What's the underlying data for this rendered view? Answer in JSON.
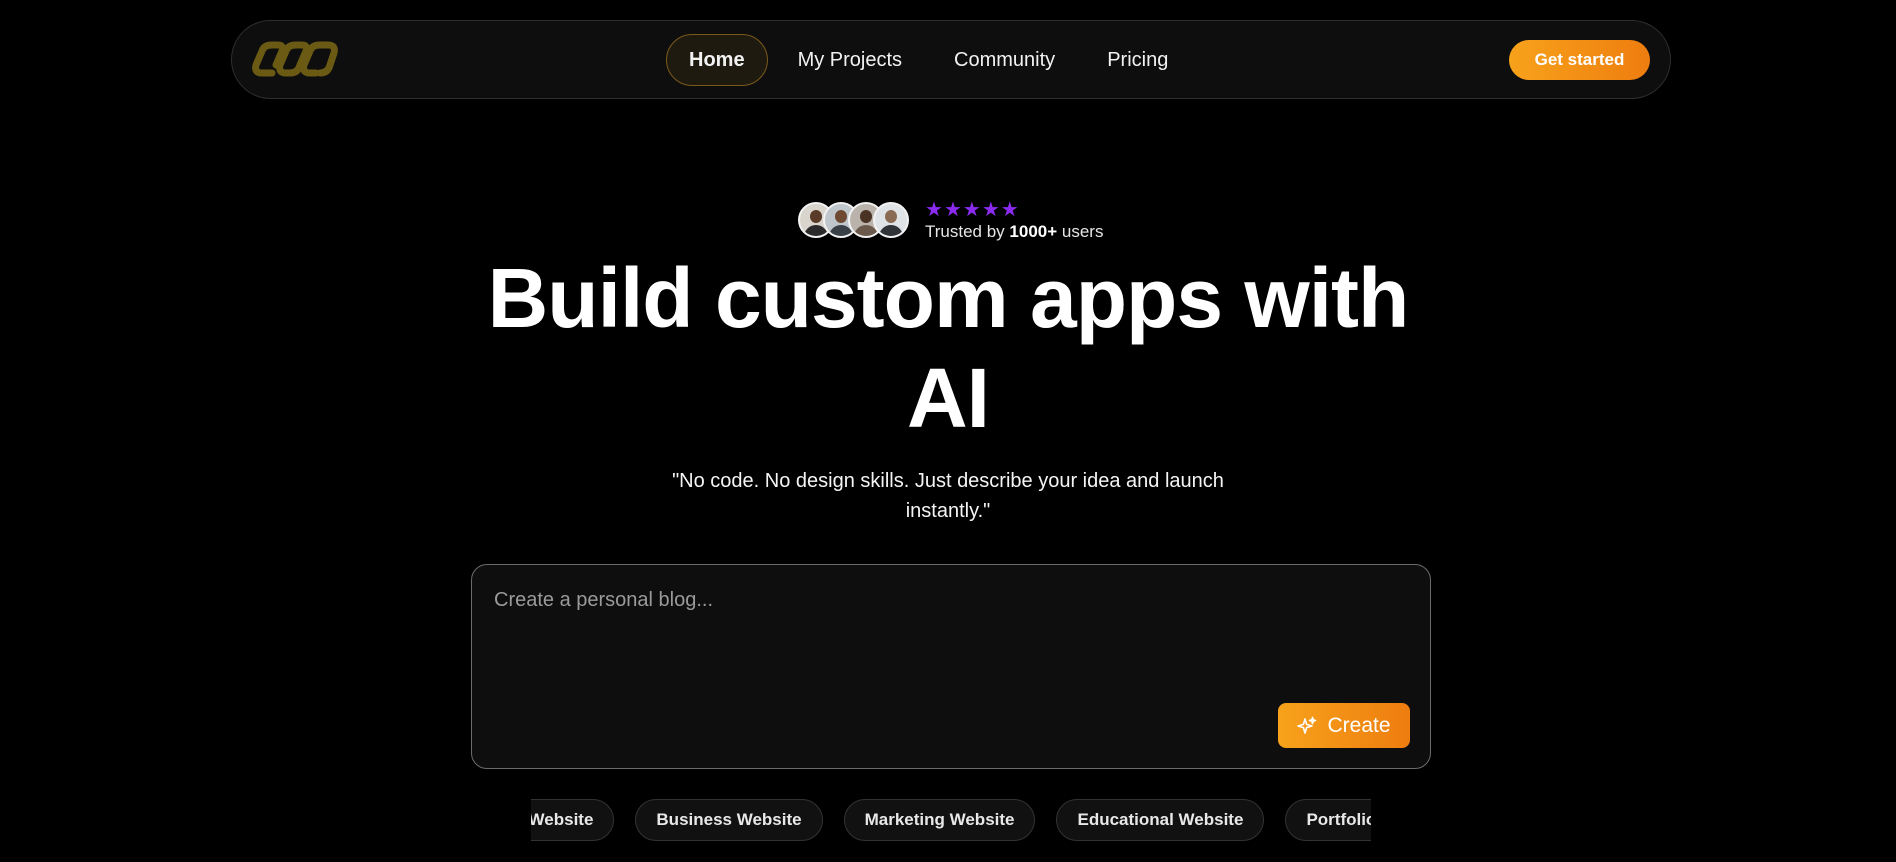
{
  "colors": {
    "accent": "#f59a18",
    "star": "#8b2bf2",
    "logo": "#6b5a14"
  },
  "nav": {
    "logo_icon": "infinity-chain-icon",
    "links": [
      {
        "label": "Home",
        "active": true
      },
      {
        "label": "My Projects",
        "active": false
      },
      {
        "label": "Community",
        "active": false
      },
      {
        "label": "Pricing",
        "active": false
      }
    ],
    "cta_label": "Get started"
  },
  "trust": {
    "rating": 5,
    "prefix": "Trusted by ",
    "count": "1000+",
    "suffix": " users"
  },
  "hero": {
    "headline_line1": "Build custom apps with",
    "headline_line2": "AI",
    "subline_line1": "\"No code. No design skills. Just describe your idea and launch",
    "subline_line2": "instantly.\""
  },
  "prompt": {
    "placeholder": "Create a personal blog...",
    "create_label": "Create",
    "create_icon": "sparkles-icon"
  },
  "chips": [
    "Personal Website",
    "Business Website",
    "Marketing Website",
    "Educational Website",
    "Portfolio Website"
  ]
}
